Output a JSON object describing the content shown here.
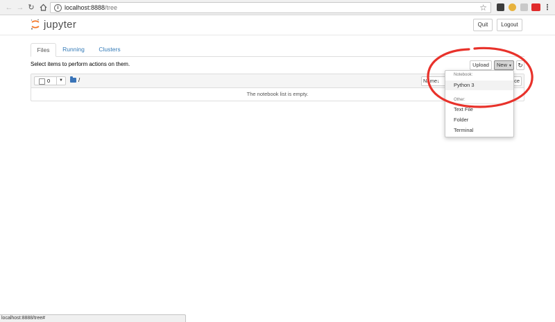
{
  "browser": {
    "url_host": "localhost:8888",
    "url_path": "/tree",
    "back_icon": "arrow-left-icon",
    "forward_icon": "arrow-right-icon",
    "reload_icon": "reload-icon",
    "home_icon": "home-icon",
    "bookmark_icon": "star-icon",
    "menu_icon": "kebab-menu-icon",
    "status_text": "localhost:8888/tree#"
  },
  "header": {
    "logo_text": "jupyter",
    "logo_color": "#f37626",
    "quit_label": "Quit",
    "logout_label": "Logout"
  },
  "tabs": [
    {
      "label": "Files",
      "active": true
    },
    {
      "label": "Running",
      "active": false
    },
    {
      "label": "Clusters",
      "active": false
    }
  ],
  "toolbar": {
    "hint": "Select items to perform actions on them.",
    "upload_label": "Upload",
    "new_label": "New",
    "refresh_icon": "refresh-icon"
  },
  "list": {
    "selected_count": "0",
    "breadcrumb": "/",
    "name_col": "Name",
    "sort_icon": "arrow-down-icon",
    "size_col_fragment": "ce",
    "empty_message": "The notebook list is empty."
  },
  "new_menu": {
    "notebook_header": "Notebook:",
    "notebook_items": [
      "Python 3"
    ],
    "other_header": "Other:",
    "other_items": [
      "Text File",
      "Folder",
      "Terminal"
    ]
  },
  "colors": {
    "link": "#337ab7",
    "annotation": "#e8322b",
    "folder": "#3a74b8"
  }
}
